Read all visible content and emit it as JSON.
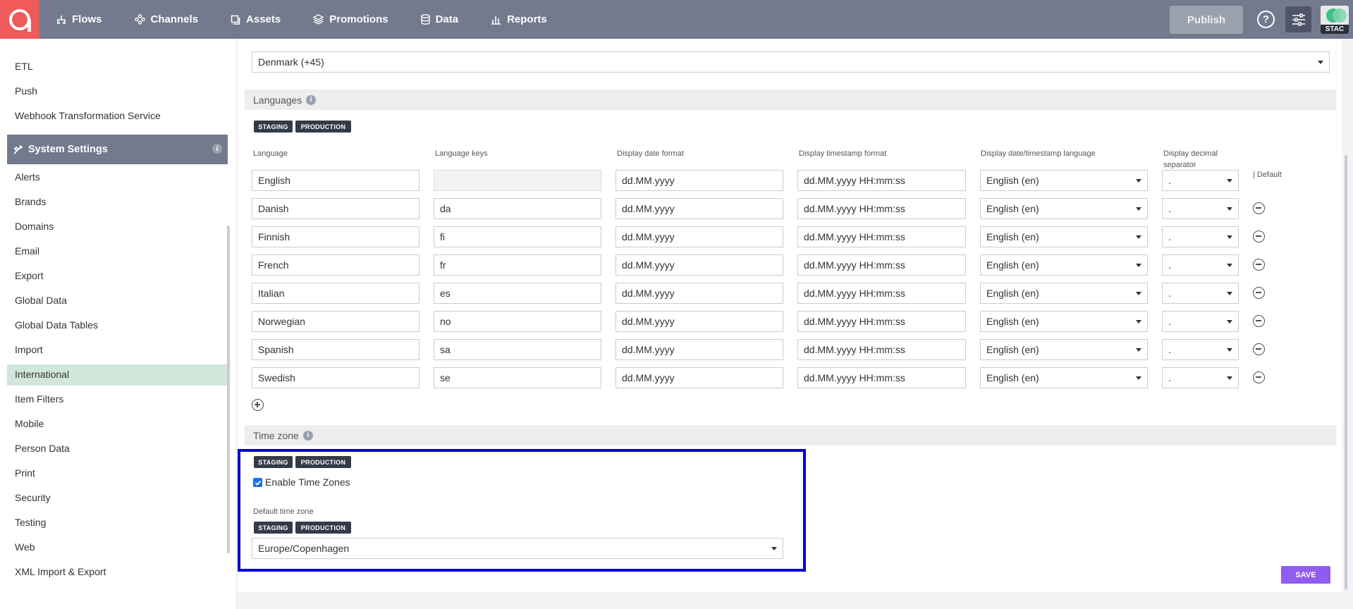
{
  "nav": {
    "items": [
      {
        "label": "Flows",
        "icon": "flows-icon"
      },
      {
        "label": "Channels",
        "icon": "channels-icon"
      },
      {
        "label": "Assets",
        "icon": "assets-icon"
      },
      {
        "label": "Promotions",
        "icon": "promotions-icon"
      },
      {
        "label": "Data",
        "icon": "database-icon"
      },
      {
        "label": "Reports",
        "icon": "reports-icon"
      }
    ],
    "publish_label": "Publish",
    "help_label": "?",
    "env_badge": "STAC"
  },
  "sidebar": {
    "top_items": [
      "ETL",
      "Push",
      "Webhook Transformation Service"
    ],
    "section_title": "System Settings",
    "section_info": "i",
    "items": [
      "Alerts",
      "Brands",
      "Domains",
      "Email",
      "Export",
      "Global Data",
      "Global Data Tables",
      "Import",
      "International",
      "Item Filters",
      "Mobile",
      "Person Data",
      "Print",
      "Security",
      "Testing",
      "Web",
      "XML Import & Export"
    ],
    "active_item": "International"
  },
  "main": {
    "country_select": "Denmark (+45)",
    "languages": {
      "title": "Languages",
      "info": "i",
      "tags": [
        "STAGING",
        "PRODUCTION"
      ],
      "columns": {
        "language": "Language",
        "keys": "Language keys",
        "date_format": "Display date format",
        "timestamp_format": "Display timestamp format",
        "date_language": "Display date/timestamp language",
        "decimal_line1": "Display decimal",
        "decimal_line2": "separator",
        "default": "| Default"
      },
      "rows": [
        {
          "name": "English",
          "key": "",
          "date": "dd.MM.yyyy",
          "timestamp": "dd.MM.yyyy HH:mm:ss",
          "lang": "English (en)",
          "decimal": "."
        },
        {
          "name": "Danish",
          "key": "da",
          "date": "dd.MM.yyyy",
          "timestamp": "dd.MM.yyyy HH:mm:ss",
          "lang": "English (en)",
          "decimal": "."
        },
        {
          "name": "Finnish",
          "key": "fi",
          "date": "dd.MM.yyyy",
          "timestamp": "dd.MM.yyyy HH:mm:ss",
          "lang": "English (en)",
          "decimal": "."
        },
        {
          "name": "French",
          "key": "fr",
          "date": "dd.MM.yyyy",
          "timestamp": "dd.MM.yyyy HH:mm:ss",
          "lang": "English (en)",
          "decimal": "."
        },
        {
          "name": "Italian",
          "key": "es",
          "date": "dd.MM.yyyy",
          "timestamp": "dd.MM.yyyy HH:mm:ss",
          "lang": "English (en)",
          "decimal": "."
        },
        {
          "name": "Norwegian",
          "key": "no",
          "date": "dd.MM.yyyy",
          "timestamp": "dd.MM.yyyy HH:mm:ss",
          "lang": "English (en)",
          "decimal": "."
        },
        {
          "name": "Spanish",
          "key": "sa",
          "date": "dd.MM.yyyy",
          "timestamp": "dd.MM.yyyy HH:mm:ss",
          "lang": "English (en)",
          "decimal": "."
        },
        {
          "name": "Swedish",
          "key": "se",
          "date": "dd.MM.yyyy",
          "timestamp": "dd.MM.yyyy HH:mm:ss",
          "lang": "English (en)",
          "decimal": "."
        }
      ]
    },
    "timezone": {
      "title": "Time zone",
      "info": "i",
      "tags": [
        "STAGING",
        "PRODUCTION"
      ],
      "enable_label": "Enable Time Zones",
      "enabled": true,
      "default_label": "Default time zone",
      "default_tags": [
        "STAGING",
        "PRODUCTION"
      ],
      "default_value": "Europe/Copenhagen"
    },
    "save_label": "SAVE"
  },
  "colors": {
    "topbar": "#737a8e",
    "logo": "#f05a5a",
    "active_item": "#d2e7dc",
    "highlight": "#0000d6",
    "save": "#8f5bf0"
  }
}
